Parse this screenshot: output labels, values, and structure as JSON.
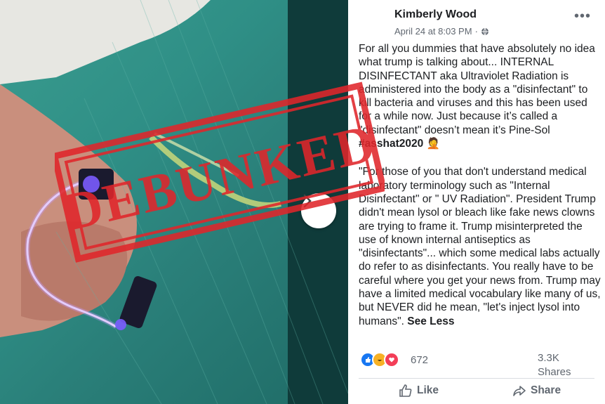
{
  "post": {
    "author": "Kimberly Wood",
    "timestamp": "April 24 at 8:03 PM",
    "separator": "·",
    "more_label": "•••",
    "paragraphs": [
      "For all you dummies that have absolutely no idea what trump is talking about... INTERNAL DISINFECTANT aka Ultraviolet Radiation is administered into the body as a \"disinfectant\" to kill bacteria and viruses and this has been used for a while now. Just because it’s called a \"disinfectant\" doesn’t mean it’s Pine-Sol",
      "\"For those of you that don't understand medical laboratory terminology such as \"Internal Disinfectant\" or \" UV Radiation\". President Trump didn't mean lysol or bleach like fake news clowns are trying to frame it. Trump misinterpreted the use of known internal antiseptics as \"disinfectants\"... which some medical labs actually do refer to as disinfectants. You really have to be careful where you get your news from. Trump may have a limited medical vocabulary like many of us, but NEVER did he mean, \"let's inject lysol into humans\"."
    ],
    "hashtag": "#asshat2020",
    "see_less": "See Less",
    "reaction_count": "672",
    "shares_count": "3.3K",
    "shares_label": "Shares",
    "like_label": "Like",
    "share_label": "Share"
  },
  "stamp": {
    "text": "DEBUNKED",
    "color": "#e0262b"
  },
  "icons": [
    "globe-icon",
    "chevron-right-icon",
    "like-icon",
    "share-icon",
    "like-reaction-icon",
    "haha-reaction-icon",
    "love-reaction-icon"
  ]
}
